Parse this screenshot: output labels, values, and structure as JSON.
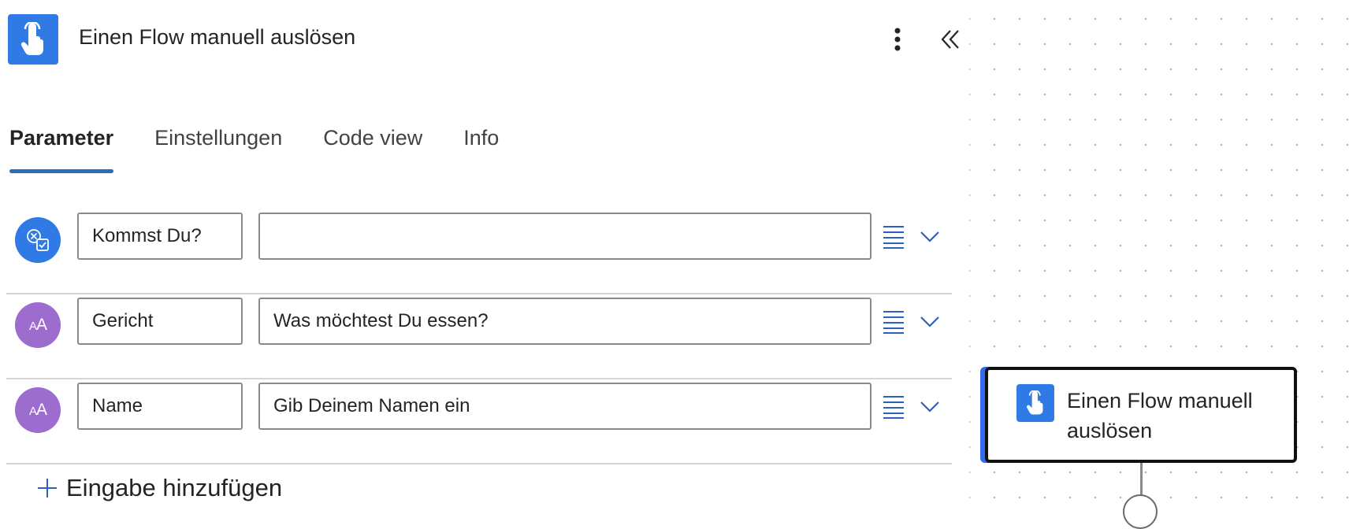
{
  "header": {
    "title": "Einen Flow manuell auslösen",
    "icon": "hand-touch-icon",
    "more_icon": "more-vertical-icon",
    "collapse_icon": "double-chevron-left-icon"
  },
  "tabs": [
    {
      "label": "Parameter",
      "active": true
    },
    {
      "label": "Einstellungen",
      "active": false
    },
    {
      "label": "Code view",
      "active": false
    },
    {
      "label": "Info",
      "active": false
    }
  ],
  "inputs": [
    {
      "type_icon": "yes-no-icon",
      "name": "Kommst Du?",
      "description": ""
    },
    {
      "type_icon": "text-icon",
      "name": "Gericht",
      "description": "Was möchtest Du essen?"
    },
    {
      "type_icon": "text-icon",
      "name": "Name",
      "description": "Gib Deinem Namen ein"
    }
  ],
  "add_input": {
    "label": "Eingabe hinzufügen"
  },
  "canvas": {
    "node": {
      "title": "Einen Flow manuell auslösen",
      "icon": "hand-touch-icon"
    }
  },
  "colors": {
    "accent": "#2f7ae5",
    "tab_underline": "#2f6cb5",
    "text_type_avatar": "#9d6ccf",
    "node_selected_edge": "#2f6cf0"
  }
}
